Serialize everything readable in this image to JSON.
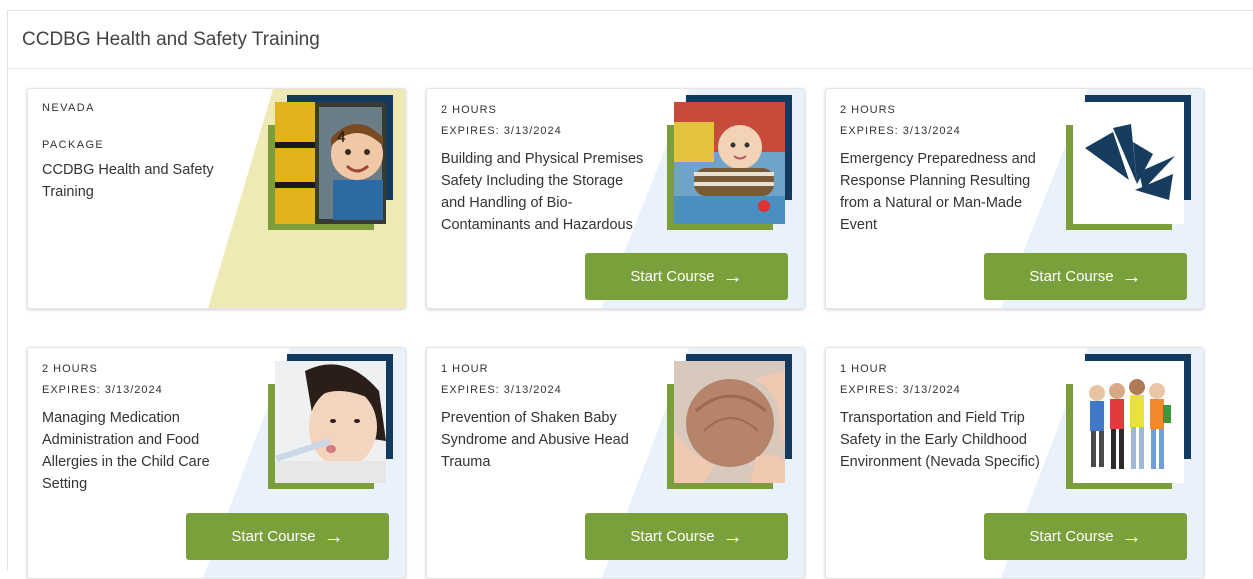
{
  "panel": {
    "title": "CCDBG Health and Safety Training"
  },
  "cards": [
    {
      "region": "NEVADA",
      "type": "PACKAGE",
      "title": "CCDBG Health and Safety Training",
      "image": "child-in-school-bus-window"
    },
    {
      "hours": "2 HOURS",
      "expires": "EXPIRES: 3/13/2024",
      "title": "Building and Physical Premises Safety Including the Storage and Handling of Bio-Contaminants and Hazardous",
      "button": "Start Course",
      "image": "baby-crawling"
    },
    {
      "hours": "2 HOURS",
      "expires": "EXPIRES: 3/13/2024",
      "title": "Emergency Preparedness and Response Planning Resulting from a Natural or Man-Made Event",
      "button": "Start Course",
      "image": "leaf-logo"
    },
    {
      "hours": "2 HOURS",
      "expires": "EXPIRES: 3/13/2024",
      "title": "Managing Medication Administration and Food Allergies in the Child Care Setting",
      "button": "Start Course",
      "image": "child-taking-medicine"
    },
    {
      "hours": "1 HOUR",
      "expires": "EXPIRES: 3/13/2024",
      "title": "Prevention of Shaken Baby Syndrome and Abusive Head Trauma",
      "button": "Start Course",
      "image": "hands-holding-baby-head"
    },
    {
      "hours": "1 HOUR",
      "expires": "EXPIRES: 3/13/2024",
      "title": "Transportation and Field Trip Safety in the Early Childhood Environment (Nevada Specific)",
      "button": "Start Course",
      "image": "children-with-backpacks"
    }
  ],
  "colors": {
    "accent_green": "#7aa03b",
    "navy": "#12395e",
    "package_bg": "#efe9b5",
    "course_bg": "#e9f2fb"
  }
}
